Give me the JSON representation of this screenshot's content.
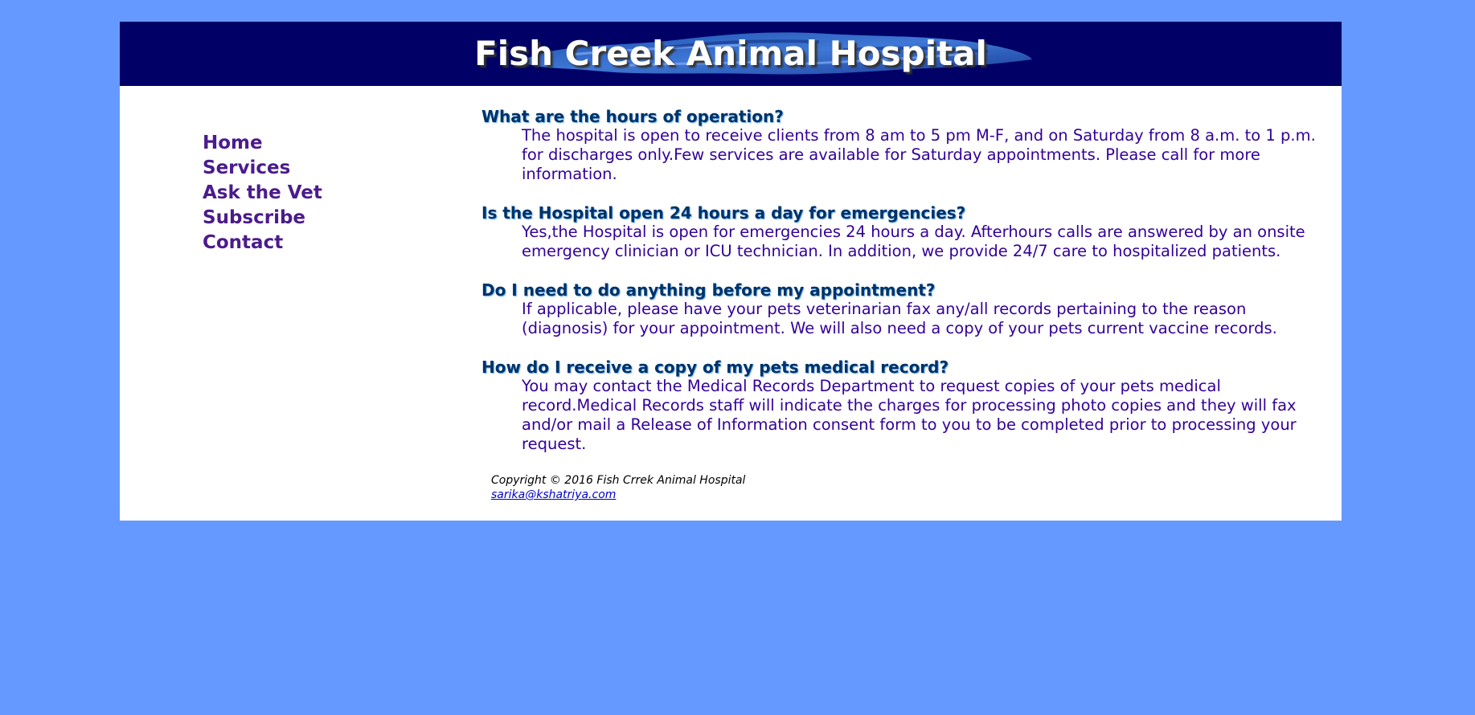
{
  "header": {
    "title": "Fish Creek Animal Hospital"
  },
  "nav": {
    "items": [
      {
        "label": "Home"
      },
      {
        "label": "Services"
      },
      {
        "label": "Ask the Vet"
      },
      {
        "label": "Subscribe"
      },
      {
        "label": "Contact"
      }
    ]
  },
  "faq": [
    {
      "question": "What are the hours of operation?",
      "answer": "The hospital is open to receive clients from 8 am to 5 pm M-F, and on Saturday from 8 a.m. to 1 p.m. for discharges only.Few services are available for Saturday appointments. Please call for more information."
    },
    {
      "question": "Is the Hospital open 24 hours a day for emergencies?",
      "answer": "Yes,the Hospital is open for emergencies 24 hours a day. Afterhours calls are answered by an onsite emergency clinician or ICU technician. In addition, we provide 24/7 care to hospitalized patients."
    },
    {
      "question": "Do I need to do anything before my appointment?",
      "answer": "If applicable, please have your pets veterinarian fax any/all records pertaining to the reason (diagnosis) for your appointment. We will also need a copy of your pets current vaccine records."
    },
    {
      "question": "How do I receive a copy of my pets medical record?",
      "answer": "You may contact the Medical Records Department to request copies of your pets medical record.Medical Records staff will indicate the charges for processing photo copies and they will fax and/or mail a Release of Information consent form to you to be completed prior to processing your request."
    }
  ],
  "footer": {
    "copyright": "Copyright © 2016 Fish Crrek Animal Hospital",
    "email": "sarika@kshatriya.com"
  },
  "colors": {
    "page_background": "#6699ff",
    "header_background": "#000066",
    "nav_link": "#4b1b8c",
    "question": "#003366",
    "answer": "#330099"
  }
}
